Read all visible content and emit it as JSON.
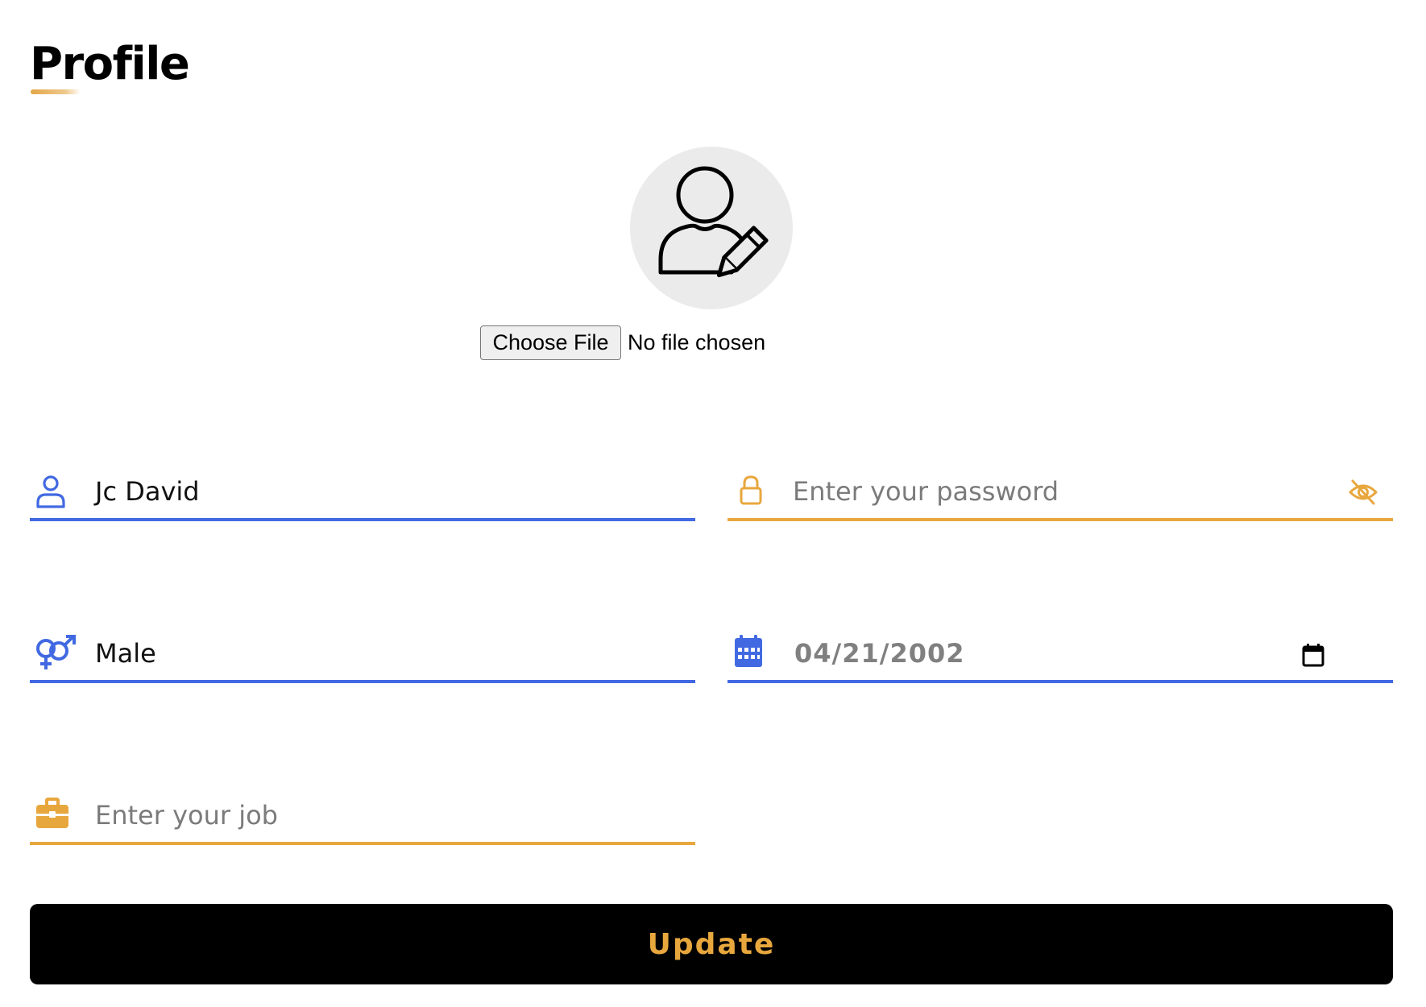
{
  "page": {
    "title": "Profile",
    "accent_gold": "#e8a73d",
    "accent_blue": "#4169e1"
  },
  "avatar": {
    "icon": "user-edit-icon"
  },
  "file_input": {
    "button_label": "Choose File",
    "status_text": "No file chosen"
  },
  "form": {
    "name": {
      "icon": "user-icon",
      "value": "Jc David"
    },
    "password": {
      "icon": "lock-icon",
      "placeholder": "Enter your password",
      "toggle_icon": "eye-slash-icon"
    },
    "gender": {
      "icon": "gender-icon",
      "value": "Male"
    },
    "dob": {
      "icon": "calendar-icon",
      "value": "04/21/2002",
      "picker_icon": "calendar-picker-icon"
    },
    "job": {
      "icon": "briefcase-icon",
      "placeholder": "Enter your job"
    }
  },
  "actions": {
    "update_label": "Update"
  }
}
